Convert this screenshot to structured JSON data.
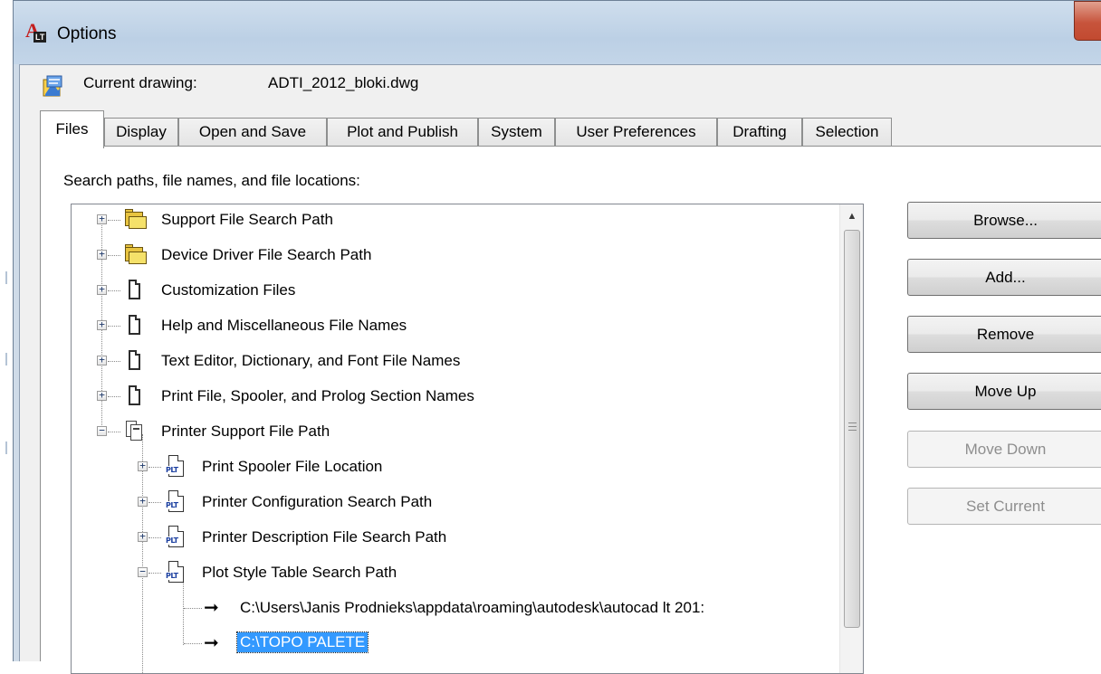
{
  "window": {
    "title": "Options",
    "title_icon": "autocad-lt-icon",
    "close_icon": "close-icon"
  },
  "current_drawing": {
    "label": "Current drawing:",
    "value": "ADTI_2012_bloki.dwg",
    "icon": "drawing-icon"
  },
  "tabs": [
    {
      "label": "Files",
      "active": true
    },
    {
      "label": "Display"
    },
    {
      "label": "Open and Save"
    },
    {
      "label": "Plot and Publish"
    },
    {
      "label": "System"
    },
    {
      "label": "User Preferences"
    },
    {
      "label": "Drafting"
    },
    {
      "label": "Selection"
    }
  ],
  "files": {
    "section_label": "Search paths, file names, and file locations:",
    "tree": [
      {
        "label": "Support File Search Path",
        "icon": "folder-stack-icon",
        "expanded": false
      },
      {
        "label": "Device Driver File Search Path",
        "icon": "folder-stack-icon",
        "expanded": false
      },
      {
        "label": "Customization Files",
        "icon": "document-icon",
        "expanded": false
      },
      {
        "label": "Help and Miscellaneous File Names",
        "icon": "document-icon",
        "expanded": false
      },
      {
        "label": "Text Editor, Dictionary, and Font File Names",
        "icon": "document-icon",
        "expanded": false
      },
      {
        "label": "Print File, Spooler, and Prolog Section Names",
        "icon": "document-icon",
        "expanded": false
      },
      {
        "label": "Printer Support File Path",
        "icon": "documents-icon",
        "expanded": true
      },
      {
        "label": "Print Spooler File Location",
        "icon": "plt-file-icon",
        "expanded": false,
        "level": 1
      },
      {
        "label": "Printer Configuration Search Path",
        "icon": "plt-file-icon",
        "expanded": false,
        "level": 1
      },
      {
        "label": "Printer Description File Search Path",
        "icon": "plt-file-icon",
        "expanded": false,
        "level": 1
      },
      {
        "label": "Plot Style Table Search Path",
        "icon": "plt-file-icon",
        "expanded": true,
        "level": 1
      },
      {
        "label": "C:\\Users\\Janis Prodnieks\\appdata\\roaming\\autodesk\\autocad lt 201:",
        "icon": "arrow-right-icon",
        "level": 2
      },
      {
        "label": "C:\\TOPO PALETE",
        "icon": "arrow-right-icon",
        "level": 2,
        "selected": true
      }
    ],
    "buttons": {
      "browse": "Browse...",
      "add": "Add...",
      "remove": "Remove",
      "move_up": "Move Up",
      "move_down": "Move Down",
      "set_current": "Set Current"
    },
    "disabled_buttons": [
      "Move Down",
      "Set Current"
    ]
  },
  "colors": {
    "selection": "#3399ff",
    "window_frame": "#cfdbe8",
    "close_button": "#c7543c"
  }
}
